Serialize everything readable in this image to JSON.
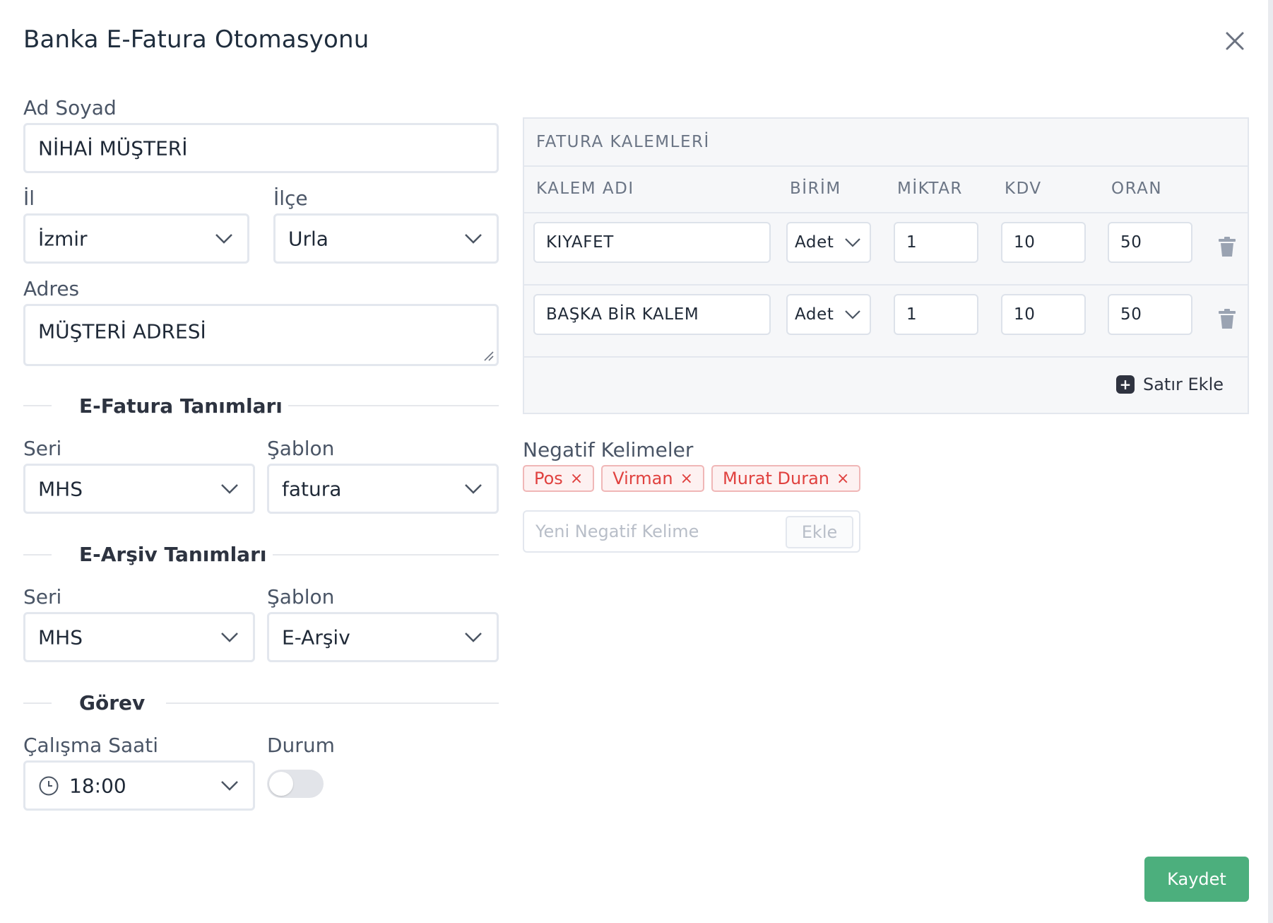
{
  "dialog": {
    "title": "Banka E-Fatura Otomasyonu",
    "close_icon": "close-icon"
  },
  "customer": {
    "name_label": "Ad Soyad",
    "name_value": "NİHAİ MÜŞTERİ",
    "city_label": "İl",
    "city_value": "İzmir",
    "district_label": "İlçe",
    "district_value": "Urla",
    "address_label": "Adres",
    "address_value": "MÜŞTERİ ADRESİ"
  },
  "efatura": {
    "section_title": "E-Fatura Tanımları",
    "series_label": "Seri",
    "series_value": "MHS",
    "template_label": "Şablon",
    "template_value": "fatura"
  },
  "earsiv": {
    "section_title": "E-Arşiv Tanımları",
    "series_label": "Seri",
    "series_value": "MHS",
    "template_label": "Şablon",
    "template_value": "E-Arşiv"
  },
  "task": {
    "section_title": "Görev",
    "time_label": "Çalışma Saati",
    "time_value": "18:00",
    "status_label": "Durum",
    "status_on": false
  },
  "items": {
    "title": "FATURA KALEMLERİ",
    "columns": [
      "KALEM ADI",
      "BİRİM",
      "MİKTAR",
      "KDV",
      "ORAN"
    ],
    "rows": [
      {
        "name": "KIYAFET",
        "unit": "Adet",
        "quantity": "1",
        "vat": "10",
        "rate": "50"
      },
      {
        "name": "BAŞKA BİR KALEM",
        "unit": "Adet",
        "quantity": "1",
        "vat": "10",
        "rate": "50"
      }
    ],
    "add_row_label": "Satır Ekle"
  },
  "negatives": {
    "label": "Negatif Kelimeler",
    "tags": [
      "Pos",
      "Virman",
      "Murat Duran"
    ],
    "input_placeholder": "Yeni Negatif Kelime",
    "add_label": "Ekle",
    "tag_color": "#e0413f"
  },
  "footer": {
    "save_label": "Kaydet",
    "save_color": "#4caf7d"
  }
}
